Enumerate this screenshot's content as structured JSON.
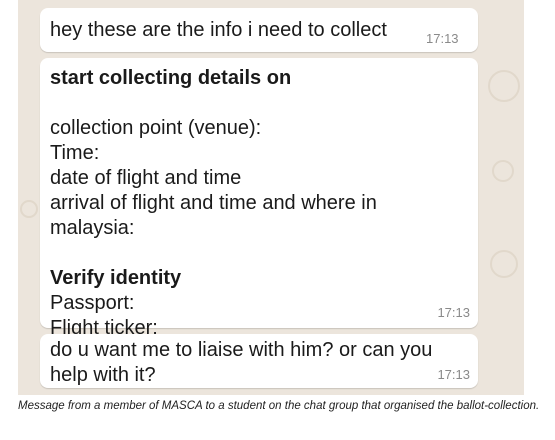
{
  "messages": [
    {
      "text": "hey these are the info i need to collect",
      "time": "17:13"
    },
    {
      "heading": "start collecting details on",
      "lines": [
        "collection point (venue):",
        "Time:",
        "date of flight and time",
        "arrival of flight and time and where in malaysia:"
      ],
      "subheading": "Verify identity",
      "lines2": [
        "Passport:",
        "Flight ticker:"
      ],
      "time": "17:13"
    },
    {
      "text": "do u want me to liaise with him? or can you help with it?",
      "time": "17:13"
    }
  ],
  "caption": "Message from a member of MASCA to a student on the chat group that organised the ballot-collection.",
  "colors": {
    "chat_background": "#ece5dc",
    "bubble": "#ffffff",
    "timestamp": "#8a8a8a"
  }
}
